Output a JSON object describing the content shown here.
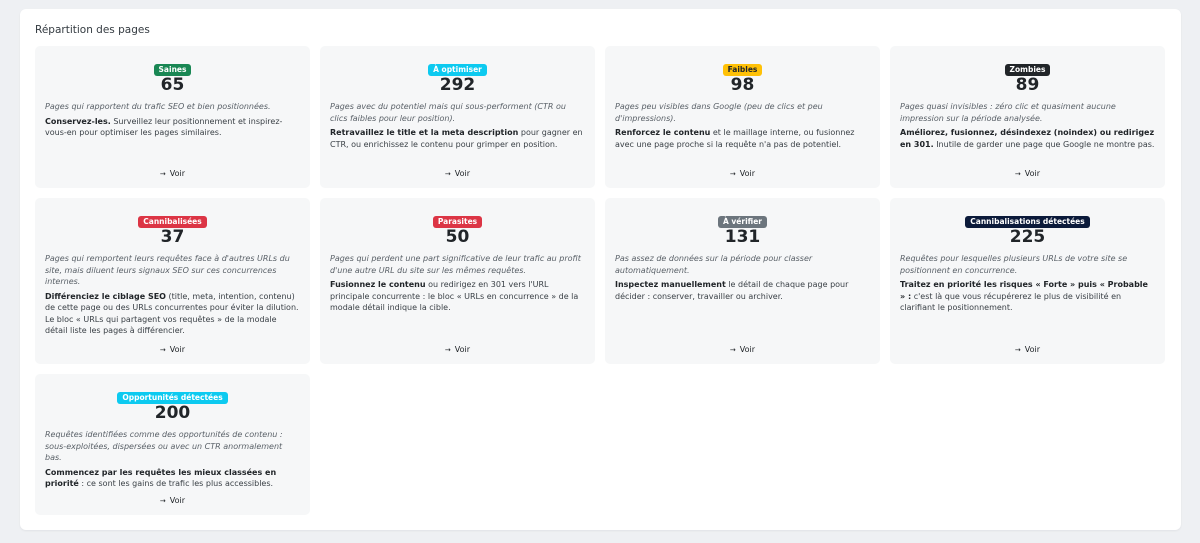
{
  "panel": {
    "title": "Répartition des pages"
  },
  "voir_label": "Voir",
  "cards": [
    {
      "badge": "Saines",
      "badge_color": "#198754",
      "count": "65",
      "desc": "Pages qui rapportent du trafic SEO et bien positionnées.",
      "advice_bold": "Conservez-les.",
      "advice_rest": " Surveillez leur positionnement et inspirez-vous-en pour optimiser les pages similaires."
    },
    {
      "badge": "À optimiser",
      "badge_color": "#0dcaf0",
      "count": "292",
      "desc": "Pages avec du potentiel mais qui sous-performent (CTR ou clics faibles pour leur position).",
      "advice_bold": "Retravaillez le title et la meta description",
      "advice_rest": " pour gagner en CTR, ou enrichissez le contenu pour grimper en position."
    },
    {
      "badge": "Faibles",
      "badge_color": "#ffc107",
      "count": "98",
      "desc": "Pages peu visibles dans Google (peu de clics et peu d'impressions).",
      "advice_bold": "Renforcez le contenu",
      "advice_rest": " et le maillage interne, ou fusionnez avec une page proche si la requête n'a pas de potentiel."
    },
    {
      "badge": "Zombies",
      "badge_color": "#212529",
      "count": "89",
      "desc": "Pages quasi invisibles : zéro clic et quasiment aucune impression sur la période analysée.",
      "advice_bold": "Améliorez, fusionnez, désindexez (noindex) ou redirigez en 301.",
      "advice_rest": " Inutile de garder une page que Google ne montre pas."
    },
    {
      "badge": "Cannibalisées",
      "badge_color": "#dc3545",
      "count": "37",
      "desc": "Pages qui remportent leurs requêtes face à d'autres URLs du site, mais diluent leurs signaux SEO sur ces concurrences internes.",
      "advice_bold": "Différenciez le ciblage SEO",
      "advice_rest": " (title, meta, intention, contenu) de cette page ou des URLs concurrentes pour éviter la dilution. Le bloc « URLs qui partagent vos requêtes » de la modale détail liste les pages à différencier."
    },
    {
      "badge": "Parasites",
      "badge_color": "#dc3545",
      "count": "50",
      "desc": "Pages qui perdent une part significative de leur trafic au profit d'une autre URL du site sur les mêmes requêtes.",
      "advice_bold": "Fusionnez le contenu",
      "advice_rest": " ou redirigez en 301 vers l'URL principale concurrente : le bloc « URLs en concurrence » de la modale détail indique la cible."
    },
    {
      "badge": "À vérifier",
      "badge_color": "#6c757d",
      "count": "131",
      "desc": "Pas assez de données sur la période pour classer automatiquement.",
      "advice_bold": "Inspectez manuellement",
      "advice_rest": " le détail de chaque page pour décider : conserver, travailler ou archiver."
    },
    {
      "badge": "Cannibalisations détectées",
      "badge_color": "#0b1a3a",
      "count": "225",
      "desc": "Requêtes pour lesquelles plusieurs URLs de votre site se positionnent en concurrence.",
      "advice_bold": "Traitez en priorité les risques « Forte » puis « Probable » :",
      "advice_rest": " c'est là que vous récupérerez le plus de visibilité en clarifiant le positionnement."
    },
    {
      "badge": "Opportunités détectées",
      "badge_color": "#0dcaf0",
      "count": "200",
      "desc": "Requêtes identifiées comme des opportunités de contenu : sous-exploitées, dispersées ou avec un CTR anormalement bas.",
      "advice_bold": "Commencez par les requêtes les mieux classées en priorité",
      "advice_rest": " : ce sont les gains de trafic les plus accessibles."
    }
  ]
}
